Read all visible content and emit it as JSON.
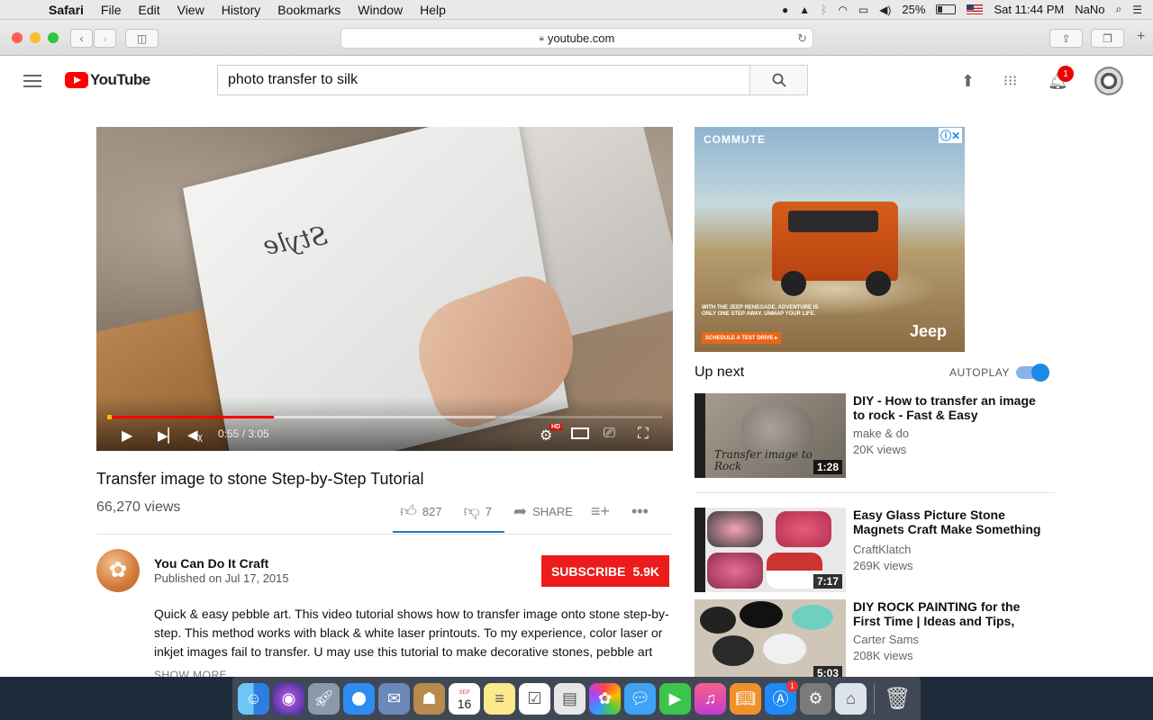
{
  "menubar": {
    "app": "Safari",
    "items": [
      "File",
      "Edit",
      "View",
      "History",
      "Bookmarks",
      "Window",
      "Help"
    ],
    "battery": "25%",
    "clock": "Sat 11:44 PM",
    "user": "NaNo"
  },
  "browser": {
    "url": "youtube.com"
  },
  "youtube": {
    "logo_text": "YouTube",
    "search_value": "photo transfer to silk",
    "notification_count": "1"
  },
  "player": {
    "time": "0:55 / 3:05",
    "hd_badge": "HD",
    "progress_fraction": 0.3
  },
  "video": {
    "title": "Transfer image to stone Step-by-Step Tutorial",
    "views": "66,270 views",
    "likes": "827",
    "dislikes": "7",
    "share_label": "SHARE"
  },
  "channel": {
    "name": "You Can Do It Craft",
    "published": "Published on Jul 17, 2015",
    "subscribe_label": "SUBSCRIBE",
    "subscriber_count": "5.9K"
  },
  "description": {
    "text": "Quick & easy pebble art. This video tutorial shows how to transfer image onto stone step-by-step. This method works with black & white laser printouts. To my experience, color laser or inkjet images fail to transfer. U may use this tutorial to make decorative stones, pebble art",
    "show_more": "SHOW MORE"
  },
  "ad": {
    "headline": "COMMUTE",
    "tagline": "WITH THE JEEP RENEGADE, ADVENTURE IS ONLY ONE STEP AWAY. UNMAP YOUR LIFE.",
    "cta": "SCHEDULE A TEST DRIVE ▸",
    "brand": "Jeep"
  },
  "sidebar": {
    "up_next": "Up next",
    "autoplay": "AUTOPLAY",
    "autoplay_on": true,
    "recommendations": [
      {
        "title": "DIY - How to transfer an image to rock - Fast & Easy",
        "channel": "make & do",
        "views": "20K views",
        "duration": "1:28",
        "thumb_text": "Transfer image to Rock"
      },
      {
        "title": "Easy Glass Picture Stone Magnets Craft Make Something",
        "channel": "CraftKlatch",
        "views": "269K views",
        "duration": "7:17"
      },
      {
        "title": "DIY ROCK PAINTING for the First Time | Ideas and Tips,",
        "channel": "Carter Sams",
        "views": "208K views",
        "duration": "5:03"
      }
    ]
  },
  "dock": {
    "calendar_month": "SEP",
    "calendar_day": "16",
    "appstore_badge": "1"
  }
}
